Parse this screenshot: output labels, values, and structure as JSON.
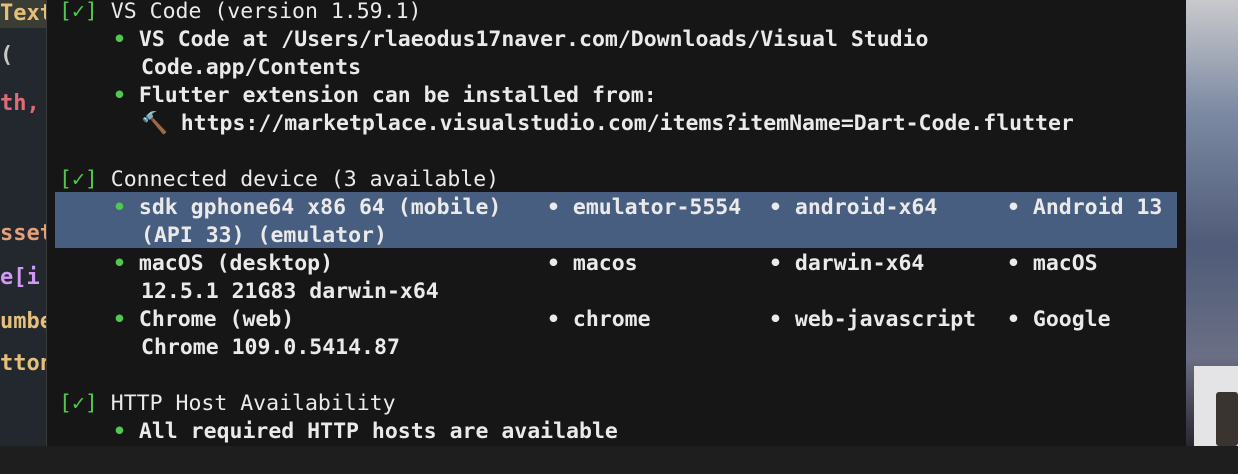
{
  "editor": {
    "fragments": [
      "Text",
      "(",
      "th,",
      "sset",
      "e[i",
      "umbe",
      "tton"
    ]
  },
  "terminal": {
    "vscode": {
      "check": "[✓]",
      "title": "VS Code (version 1.59.1)",
      "items": [
        "VS Code at /Users/rlaeodus17naver.com/Downloads/Visual Studio",
        "Code.app/Contents",
        "Flutter extension can be installed from:",
        "🔨 https://marketplace.visualstudio.com/items?itemName=Dart-Code.flutter"
      ]
    },
    "devices": {
      "check": "[✓]",
      "title": "Connected device (3 available)",
      "rows": [
        {
          "name": "sdk gphone64 x86 64 (mobile)",
          "id": "emulator-5554",
          "platform": "android-x64",
          "os": "Android 13",
          "cont": "(API 33) (emulator)"
        },
        {
          "name": "macOS (desktop)",
          "id": "macos",
          "platform": "darwin-x64",
          "os": "macOS",
          "cont": "12.5.1 21G83 darwin-x64"
        },
        {
          "name": "Chrome (web)",
          "id": "chrome",
          "platform": "web-javascript",
          "os": "Google",
          "cont": "Chrome 109.0.5414.87"
        }
      ]
    },
    "http": {
      "check": "[✓]",
      "title": "HTTP Host Availability",
      "item": "All required HTTP hosts are available"
    },
    "bullet": "•"
  },
  "colors": {
    "selection": "#485e80",
    "check_green": "#4ec94e",
    "terminal_bg": "#161616",
    "text": "#eaeaea"
  }
}
